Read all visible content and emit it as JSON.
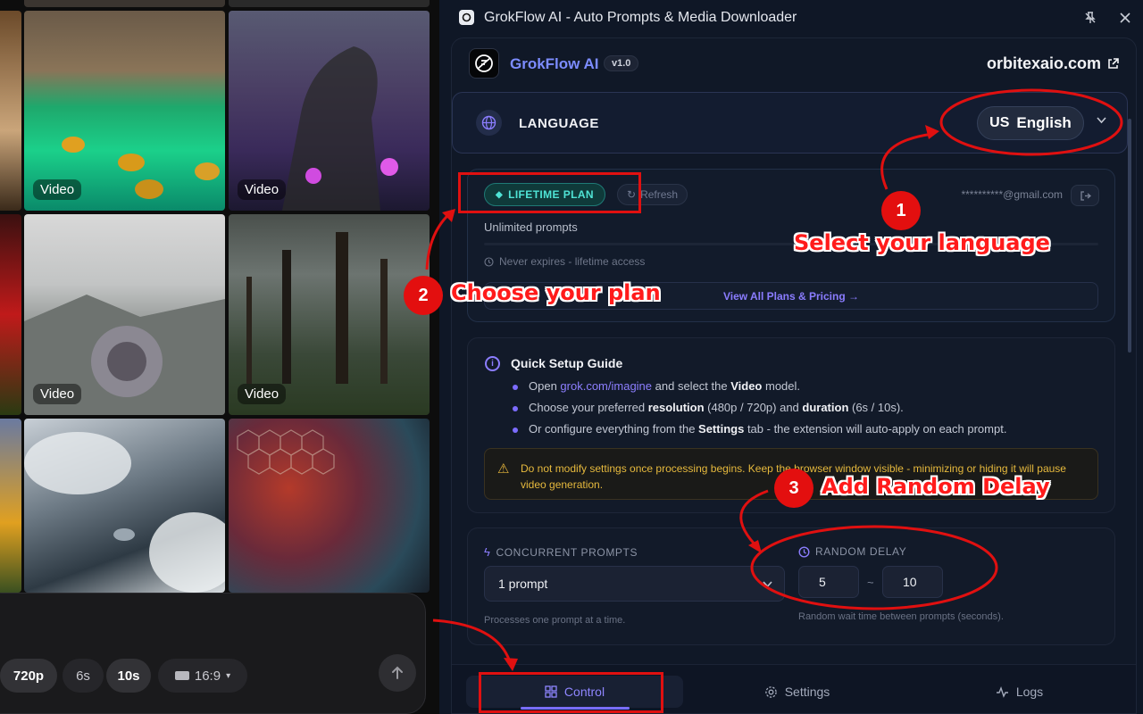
{
  "gallery": {
    "tiles": [
      {
        "badge": "Video"
      },
      {
        "badge": "Video"
      },
      {
        "badge": "Video"
      },
      {
        "badge": "Video"
      }
    ],
    "composer": {
      "resolution": "720p",
      "duration_short": "6s",
      "duration_long": "10s",
      "aspect": "16:9"
    }
  },
  "window": {
    "title": "GrokFlow AI - Auto Prompts & Media Downloader",
    "icons": [
      "pin-icon",
      "close-icon"
    ]
  },
  "header": {
    "brand": "GrokFlow AI",
    "version": "v1.0",
    "site": "orbitexaio.com"
  },
  "language": {
    "title": "LANGUAGE",
    "flag": "US",
    "selected": "English"
  },
  "plan": {
    "badge": "LIFETIME PLAN",
    "refresh": "Refresh",
    "email": "**********@gmail.com",
    "description": "Unlimited prompts",
    "expiry": "Never expires - lifetime access",
    "view_plans": "View All Plans & Pricing →"
  },
  "guide": {
    "title": "Quick Setup Guide",
    "line1": {
      "a": "Open ",
      "link": "grok.com/imagine",
      "b": " and select the ",
      "bold": "Video",
      "c": " model."
    },
    "line2": {
      "a": "Choose your preferred ",
      "bold1": "resolution",
      "b": " (480p / 720p) and ",
      "bold2": "duration",
      "c": " (6s / 10s)."
    },
    "line3": {
      "a": "Or configure everything from the ",
      "bold": "Settings",
      "b": " tab - the extension will auto-apply on each prompt."
    },
    "warning": "Do not modify settings once processing begins. Keep the browser window visible - minimizing or hiding it will pause video generation."
  },
  "concurrency": {
    "label": "CONCURRENT PROMPTS",
    "value": "1 prompt",
    "hint": "Processes one prompt at a time."
  },
  "delay": {
    "label": "RANDOM DELAY",
    "min": "5",
    "sep": "~",
    "max": "10",
    "hint": "Random wait time between prompts (seconds)."
  },
  "nav": {
    "control": "Control",
    "settings": "Settings",
    "logs": "Logs"
  },
  "annotations": {
    "n1": "1",
    "l1": "Select your language",
    "n2": "2",
    "l2": "Choose your plan",
    "n3": "3",
    "l3": "Add Random Delay"
  },
  "colors": {
    "accent": "#7c6cff",
    "annotation": "#e01010",
    "plan_badge": "#4fe3d5",
    "warning": "#e6b93d"
  }
}
